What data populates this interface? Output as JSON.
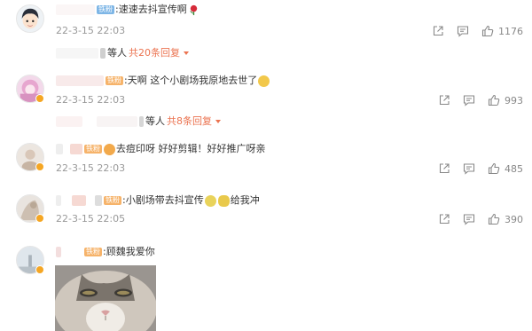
{
  "comments": [
    {
      "text": ":速速去抖宣传啊",
      "badge": "铁粉",
      "time": "22-3-15 22:03",
      "likes": "1176",
      "replies": {
        "who": "等人",
        "link": "共20条回复"
      }
    },
    {
      "text": ":天啊 这个小剧场我原地去世了",
      "badge": "铁粉",
      "time": "22-3-15 22:03",
      "likes": "993",
      "replies": {
        "who": "等人",
        "link": "共8条回复"
      }
    },
    {
      "text": "去痘印呀 好好剪辑！好好推广呀亲",
      "badge": "铁粉",
      "time": "22-3-15 22:03",
      "likes": "485"
    },
    {
      "text_a": ":小剧场带去抖宣传",
      "text_b": "给我冲",
      "badge": "铁粉",
      "time": "22-3-15 22:05",
      "likes": "390"
    },
    {
      "text": ":顾魏我爱你",
      "badge": "铁粉"
    }
  ],
  "icons": {
    "share": "share-icon",
    "comment": "comment-icon",
    "like": "thumbs-up-icon"
  },
  "colors": {
    "link": "#eb7350",
    "time": "#999999",
    "badge_orange": "#f6b36a",
    "badge_blue": "#7eb6e6"
  }
}
